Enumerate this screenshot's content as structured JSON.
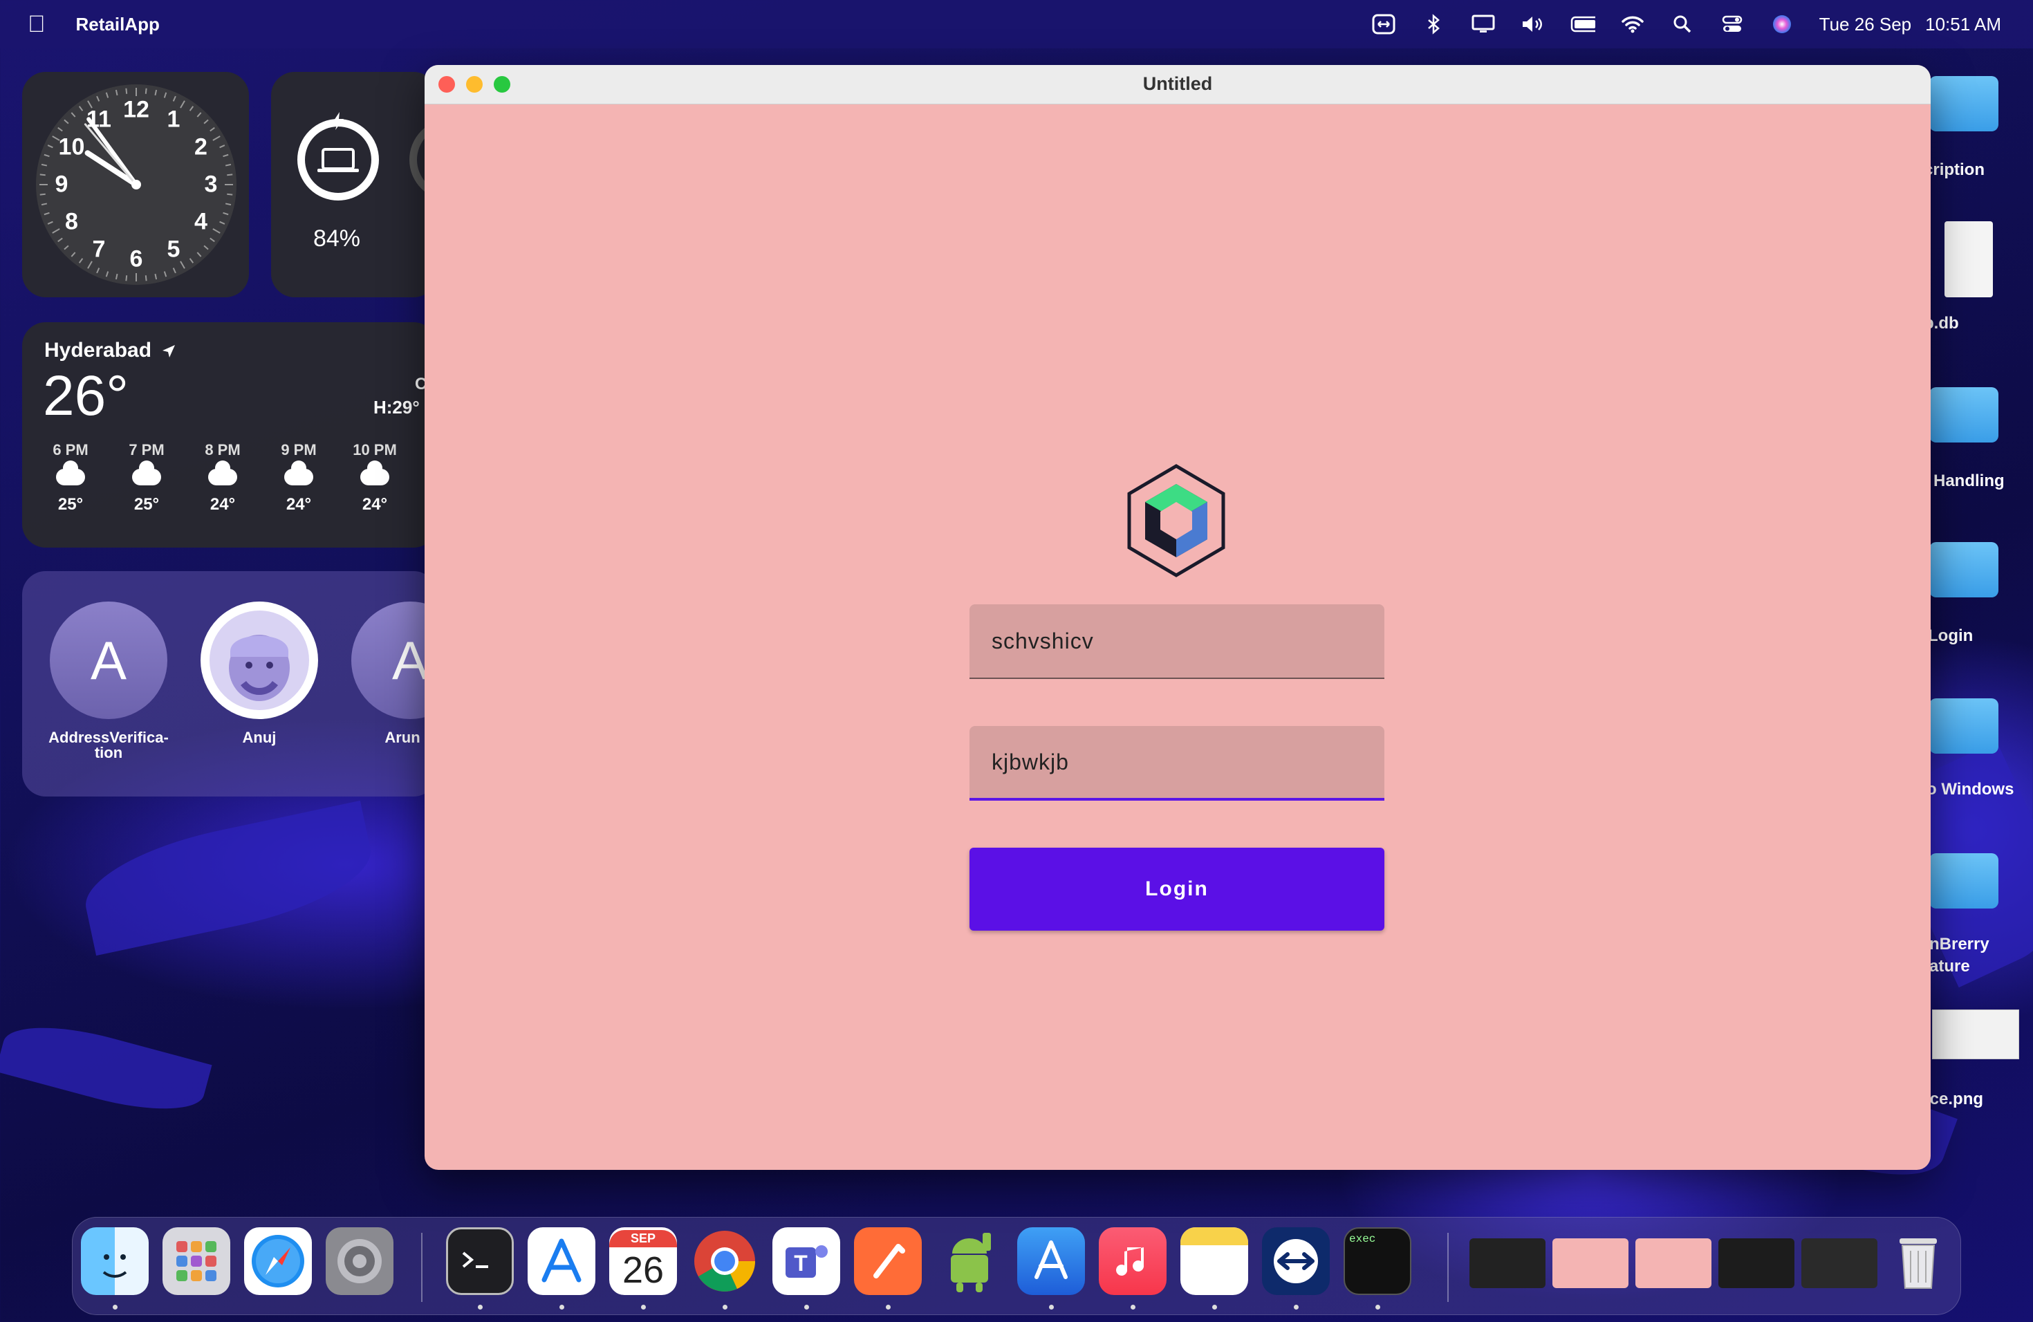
{
  "menubar": {
    "app_name": "RetailApp",
    "date": "Tue 26 Sep",
    "time": "10:51 AM"
  },
  "widgets": {
    "clock": {
      "numbers": [
        "12",
        "1",
        "2",
        "3",
        "4",
        "5",
        "6",
        "7",
        "8",
        "9",
        "10",
        "11"
      ]
    },
    "battery": {
      "percent": "84%"
    },
    "weather": {
      "city": "Hyderabad",
      "temp": "26°",
      "condition_partial": "C",
      "high_low": "H:29°",
      "hours": [
        {
          "time": "6 PM",
          "temp": "25°"
        },
        {
          "time": "7 PM",
          "temp": "25°"
        },
        {
          "time": "8 PM",
          "temp": "24°"
        },
        {
          "time": "9 PM",
          "temp": "24°"
        },
        {
          "time": "10 PM",
          "temp": "24°"
        }
      ]
    },
    "contacts": [
      {
        "initial": "A",
        "name": "AddressVerifica-\ntion"
      },
      {
        "initial": "",
        "name": "Anuj"
      },
      {
        "initial": "A",
        "name": "Arun K"
      }
    ]
  },
  "desktop_items": [
    {
      "label": "cription"
    },
    {
      "label": "p.db"
    },
    {
      "label": "Handling"
    },
    {
      "label": "Login"
    },
    {
      "label": "o Windows"
    },
    {
      "label": "nBrerry"
    },
    {
      "label": "ature"
    },
    {
      "label": "ice.png"
    }
  ],
  "window": {
    "title": "Untitled",
    "username_value": "schvshicv",
    "password_value": "kjbwkjb",
    "login_label": "Login"
  },
  "dock": {
    "calendar_month": "SEP",
    "calendar_day": "26",
    "exec_label": "exec",
    "apps": [
      "finder",
      "launchpad",
      "safari",
      "system-settings",
      "terminal",
      "xcode-instruments",
      "calendar",
      "chrome",
      "teams",
      "postman",
      "android-studio",
      "testflight",
      "music",
      "notes",
      "teamviewer",
      "exec"
    ]
  },
  "colors": {
    "window_bg": "#f4b4b3",
    "field_bg": "#d7a09f",
    "accent": "#5b10e6"
  }
}
